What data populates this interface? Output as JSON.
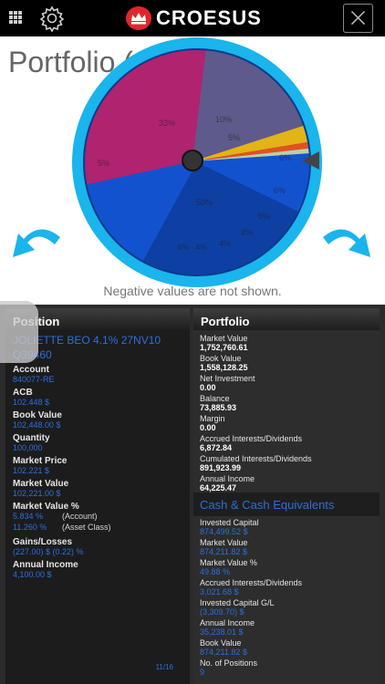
{
  "app": {
    "logo_text": "CROESUS"
  },
  "icons": {
    "grid": "grid-menu-icon",
    "gear": "gear-icon",
    "logo": "crown-logo-icon",
    "close": "close-icon",
    "rotate_left": "rotate-left-arrow-icon",
    "rotate_right": "rotate-right-arrow-icon"
  },
  "page": {
    "title": "Portfolio (CAD)"
  },
  "wheel": {
    "slice_labels": [
      "33%",
      "10%",
      "5%",
      "5%",
      "6%",
      "6%",
      "5%",
      "4%",
      "4%",
      "4%",
      "4%",
      "50%"
    ],
    "colors": {
      "ring": "#19b5ec",
      "magenta": "#b0236f",
      "slate": "#5e5a8c",
      "gold": "#e2b418",
      "orange": "#e2521f",
      "blue": "#1352cf",
      "navy": "#0b2f80"
    }
  },
  "note": "Negative values are not shown.",
  "position_panel": {
    "header": "Position",
    "name": "JOLIETTE BEO  4.1% 27NV10",
    "code": "Q39460",
    "fields": [
      {
        "label": "Account",
        "value": "840077-RE"
      },
      {
        "label": "ACB",
        "value": "102.448 $"
      },
      {
        "label": "Book Value",
        "value": "102,448.00 $"
      },
      {
        "label": "Quantity",
        "value": "100,000"
      },
      {
        "label": "Market Price",
        "value": "102.221 $"
      },
      {
        "label": "Market Value",
        "value": "102,221.00 $"
      }
    ],
    "market_value_pct": {
      "label": "Market Value %",
      "rows": [
        {
          "value": "5.834 %",
          "tag": "(Account)"
        },
        {
          "value": "11.260 %",
          "tag": "(Asset Class)"
        }
      ]
    },
    "gains": {
      "label": "Gains/Losses",
      "value": "(227.00) $  (0.22) %"
    },
    "annual_income": {
      "label": "Annual Income",
      "value": "4,100.00 $"
    },
    "pager": "11/16"
  },
  "portfolio_panel": {
    "header": "Portfolio",
    "fields": [
      {
        "label": "Market Value",
        "value": "1,752,760.61"
      },
      {
        "label": "Book Value",
        "value": "1,558,128.25"
      },
      {
        "label": "Net Investment",
        "value": "0.00"
      },
      {
        "label": "Balance",
        "value": "73,885.93"
      },
      {
        "label": "Margin",
        "value": "0.00"
      },
      {
        "label": "Accrued Interests/Dividends",
        "value": "6,872.84"
      },
      {
        "label": "Cumulated Interests/Dividends",
        "value": "891,923.99"
      },
      {
        "label": "Annual Income",
        "value": "64,225.47"
      }
    ]
  },
  "cash_panel": {
    "header": "Cash & Cash Equivalents",
    "fields": [
      {
        "label": "Invested Capital",
        "value": "874,499.52 $"
      },
      {
        "label": "Market Value",
        "value": "874,211.82 $"
      },
      {
        "label": "Market Value %",
        "value": "49.88 %"
      },
      {
        "label": "Accrued Interests/Dividends",
        "value": "3,021.68 $"
      },
      {
        "label": "Invested Capital G/L",
        "value": "(3,309.70) $"
      },
      {
        "label": "Annual Income",
        "value": "35,238.01 $"
      },
      {
        "label": "Book Value",
        "value": "874,211.82 $"
      },
      {
        "label": "No. of Positions",
        "value": "9"
      }
    ]
  }
}
